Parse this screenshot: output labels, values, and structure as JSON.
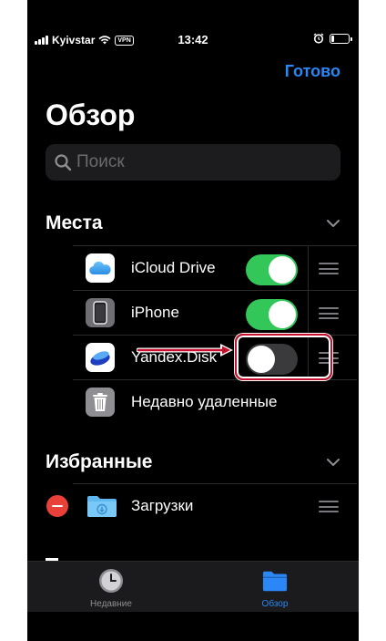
{
  "status_bar": {
    "carrier": "Kyivstar",
    "vpn": "VPN",
    "time": "13:42",
    "battery_level": 0.2
  },
  "header": {
    "done_label": "Готово",
    "title": "Обзор"
  },
  "search": {
    "placeholder": "Поиск"
  },
  "sections": {
    "places": {
      "title": "Места",
      "items": [
        {
          "label": "iCloud Drive",
          "icon": "icloud-icon",
          "enabled": true
        },
        {
          "label": "iPhone",
          "icon": "iphone-icon",
          "enabled": true
        },
        {
          "label": "Yandex.Disk",
          "icon": "yandex-disk-icon",
          "enabled": false
        },
        {
          "label": "Недавно удаленные",
          "icon": "trash-icon"
        }
      ]
    },
    "favorites": {
      "title": "Избранные",
      "items": [
        {
          "label": "Загрузки",
          "icon": "downloads-folder-icon"
        }
      ]
    }
  },
  "tabs": [
    {
      "label": "Недавние",
      "icon": "clock-icon",
      "active": false
    },
    {
      "label": "Обзор",
      "icon": "folder-icon",
      "active": true
    }
  ],
  "colors": {
    "accent": "#2b87f5",
    "toggle_on": "#33c659",
    "highlight": "#c8102e",
    "remove": "#e9403a"
  }
}
